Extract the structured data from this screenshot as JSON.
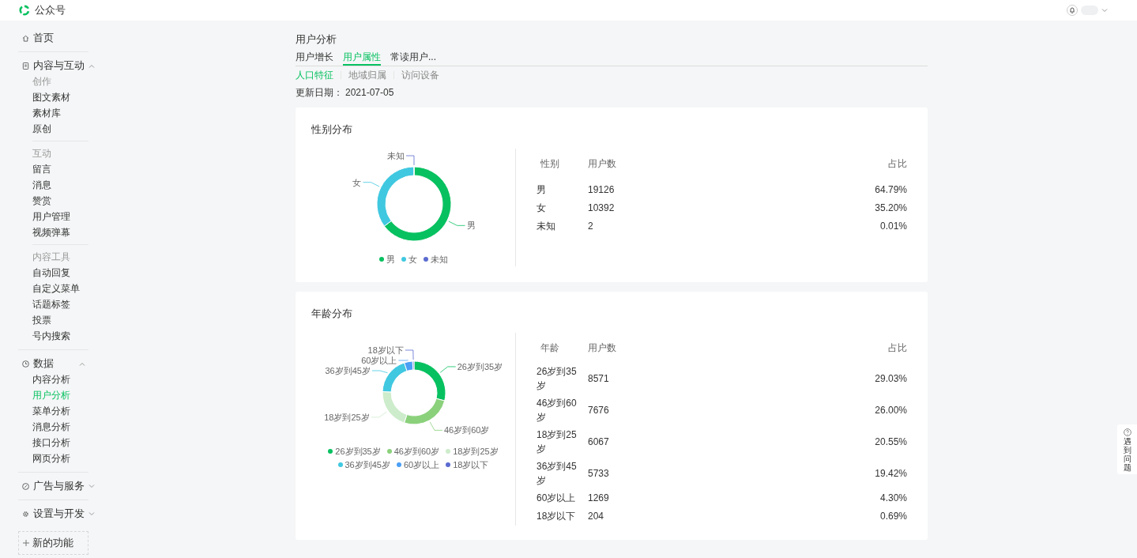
{
  "topbar": {
    "brand": "公众号"
  },
  "sidebar": {
    "home": {
      "label": "首页"
    },
    "sections": [
      {
        "label": "内容与互动",
        "expanded": true,
        "groups": [
          {
            "title": "创作",
            "items": [
              {
                "label": "图文素材",
                "selected": false
              },
              {
                "label": "素材库",
                "selected": false
              },
              {
                "label": "原创",
                "selected": false
              }
            ]
          },
          {
            "title": "互动",
            "items": [
              {
                "label": "留言",
                "selected": false
              },
              {
                "label": "消息",
                "selected": false
              },
              {
                "label": "赞赏",
                "selected": false
              },
              {
                "label": "用户管理",
                "selected": false
              },
              {
                "label": "视频弹幕",
                "selected": false
              }
            ]
          },
          {
            "title": "内容工具",
            "items": [
              {
                "label": "自动回复",
                "selected": false
              },
              {
                "label": "自定义菜单",
                "selected": false
              },
              {
                "label": "话题标签",
                "selected": false
              },
              {
                "label": "投票",
                "selected": false
              },
              {
                "label": "号内搜索",
                "selected": false
              }
            ]
          }
        ]
      },
      {
        "label": "数据",
        "expanded": true,
        "groups": [
          {
            "items": [
              {
                "label": "内容分析",
                "selected": false
              },
              {
                "label": "用户分析",
                "selected": true
              },
              {
                "label": "菜单分析",
                "selected": false
              },
              {
                "label": "消息分析",
                "selected": false
              },
              {
                "label": "接口分析",
                "selected": false
              },
              {
                "label": "网页分析",
                "selected": false
              }
            ]
          }
        ]
      },
      {
        "label": "广告与服务",
        "expanded": false
      },
      {
        "label": "设置与开发",
        "expanded": false
      }
    ],
    "new_feature": "新的功能"
  },
  "page_title": "用户分析",
  "tabs": [
    {
      "label": "用户增长",
      "selected": false
    },
    {
      "label": "用户属性",
      "selected": true
    },
    {
      "label": "常读用户...",
      "selected": false
    }
  ],
  "subtabs": [
    {
      "label": "人口特征",
      "selected": true
    },
    {
      "label": "地域归属",
      "selected": false
    },
    {
      "label": "访问设备",
      "selected": false
    }
  ],
  "update_date": {
    "label": "更新日期：",
    "value": "2021-07-05"
  },
  "cards": [
    {
      "title": "性别分布",
      "chart_data": {
        "type": "donut",
        "categories": [
          "男",
          "女",
          "未知"
        ],
        "values": [
          64.79,
          35.2,
          0.01
        ]
      },
      "legend": [
        {
          "label": "男",
          "color": "#07c160"
        },
        {
          "label": "女",
          "color": "#40c8e0"
        },
        {
          "label": "未知",
          "color": "#5b6bd0"
        }
      ],
      "table": {
        "columns": [
          "性别",
          "用户数",
          "占比"
        ],
        "rows": [
          [
            "男",
            "19126",
            "64.79%"
          ],
          [
            "女",
            "10392",
            "35.20%"
          ],
          [
            "未知",
            "2",
            "0.01%"
          ]
        ]
      }
    },
    {
      "title": "年龄分布",
      "chart_data": {
        "type": "donut",
        "categories": [
          "26岁到35岁",
          "46岁到60岁",
          "18岁到25岁",
          "36岁到45岁",
          "60岁以上",
          "18岁以下"
        ],
        "values": [
          29.03,
          26.0,
          20.55,
          19.42,
          4.3,
          0.69
        ]
      },
      "legend": [
        {
          "label": "26岁到35岁",
          "color": "#07c160"
        },
        {
          "label": "46岁到60岁",
          "color": "#8bd17c"
        },
        {
          "label": "18岁到25岁",
          "color": "#cdeccb"
        },
        {
          "label": "36岁到45岁",
          "color": "#40c8e0"
        },
        {
          "label": "60岁以上",
          "color": "#4a9ff5"
        },
        {
          "label": "18岁以下",
          "color": "#5b6bd0"
        }
      ],
      "table": {
        "columns": [
          "年龄",
          "用户数",
          "占比"
        ],
        "rows": [
          [
            "26岁到35岁",
            "8571",
            "29.03%"
          ],
          [
            "46岁到60岁",
            "7676",
            "26.00%"
          ],
          [
            "18岁到25岁",
            "6067",
            "20.55%"
          ],
          [
            "36岁到45岁",
            "5733",
            "19.42%"
          ],
          [
            "60岁以上",
            "1269",
            "4.30%"
          ],
          [
            "18岁以下",
            "204",
            "0.69%"
          ]
        ]
      }
    }
  ],
  "help_tab": "遇到问题"
}
